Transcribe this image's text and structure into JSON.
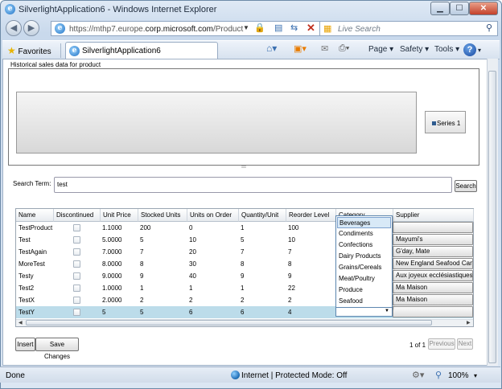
{
  "browser": {
    "title": "SilverlightApplication6 - Windows Internet Explorer",
    "url_prefix": "https://mthp7.europe.",
    "url_domain": "corp.microsoft.com",
    "url_suffix": "/Product",
    "search_placeholder": "Live Search",
    "favorites_label": "Favorites",
    "tab_label": "SilverlightApplication6",
    "menu": {
      "page": "Page ▾",
      "safety": "Safety ▾",
      "tools": "Tools ▾"
    }
  },
  "chart": {
    "title": "Historical sales data for product",
    "legend": "Series 1",
    "colors": {
      "series": "#2f5c8f"
    }
  },
  "chart_data": {
    "type": "line",
    "title": "Historical sales data for product",
    "series": [
      {
        "name": "Series 1",
        "values": []
      }
    ],
    "legend": "right",
    "xlabel": "",
    "ylabel": ""
  },
  "search": {
    "label": "Search Term:",
    "value": "test",
    "button": "Search"
  },
  "grid": {
    "headers": [
      "Name",
      "Discontinued",
      "Unit Price",
      "Stocked Units",
      "Units on Order",
      "Quantity/Unit",
      "Reorder Level",
      "Category",
      "Supplier"
    ],
    "rows": [
      {
        "name": "TestProduct",
        "price": "1.1000",
        "stocked": "200",
        "on_order": "0",
        "qty": "1",
        "reorder": "100",
        "supplier": ""
      },
      {
        "name": "Test",
        "price": "5.0000",
        "stocked": "5",
        "on_order": "10",
        "qty": "5",
        "reorder": "10",
        "supplier": "Mayumi's"
      },
      {
        "name": "TestAgain",
        "price": "7.0000",
        "stocked": "7",
        "on_order": "20",
        "qty": "7",
        "reorder": "7",
        "supplier": "G'day, Mate"
      },
      {
        "name": "MoreTest",
        "price": "8.0000",
        "stocked": "8",
        "on_order": "30",
        "qty": "8",
        "reorder": "8",
        "supplier": "New England Seafood Cannery"
      },
      {
        "name": "Testy",
        "price": "9.0000",
        "stocked": "9",
        "on_order": "40",
        "qty": "9",
        "reorder": "9",
        "supplier": "Aux joyeux ecclésiastiques"
      },
      {
        "name": "Test2",
        "price": "1.0000",
        "stocked": "1",
        "on_order": "1",
        "qty": "1",
        "reorder": "22",
        "supplier": "Ma Maison"
      },
      {
        "name": "TestX",
        "price": "2.0000",
        "stocked": "2",
        "on_order": "2",
        "qty": "2",
        "reorder": "2",
        "supplier": "Ma Maison"
      },
      {
        "name": "TestY",
        "price": "5",
        "stocked": "5",
        "on_order": "6",
        "qty": "6",
        "reorder": "4",
        "supplier": ""
      }
    ],
    "categories": [
      "Beverages",
      "Condiments",
      "Confections",
      "Dairy Products",
      "Grains/Cereals",
      "Meat/Poultry",
      "Produce",
      "Seafood"
    ]
  },
  "actions": {
    "insert": "Insert",
    "save": "Save Changes"
  },
  "pager": {
    "text": "1 of 1",
    "previous": "Previous",
    "next": "Next"
  },
  "status": {
    "left": "Done",
    "zone": "Internet | Protected Mode: Off",
    "zoom": "100%"
  }
}
